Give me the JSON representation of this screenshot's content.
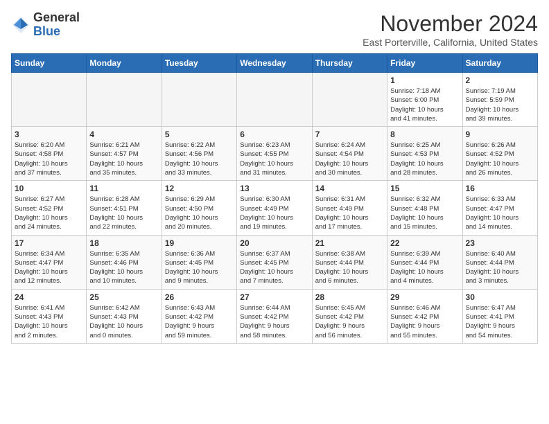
{
  "logo": {
    "general": "General",
    "blue": "Blue"
  },
  "header": {
    "title": "November 2024",
    "subtitle": "East Porterville, California, United States"
  },
  "weekdays": [
    "Sunday",
    "Monday",
    "Tuesday",
    "Wednesday",
    "Thursday",
    "Friday",
    "Saturday"
  ],
  "weeks": [
    [
      {
        "day": "",
        "info": ""
      },
      {
        "day": "",
        "info": ""
      },
      {
        "day": "",
        "info": ""
      },
      {
        "day": "",
        "info": ""
      },
      {
        "day": "",
        "info": ""
      },
      {
        "day": "1",
        "info": "Sunrise: 7:18 AM\nSunset: 6:00 PM\nDaylight: 10 hours\nand 41 minutes."
      },
      {
        "day": "2",
        "info": "Sunrise: 7:19 AM\nSunset: 5:59 PM\nDaylight: 10 hours\nand 39 minutes."
      }
    ],
    [
      {
        "day": "3",
        "info": "Sunrise: 6:20 AM\nSunset: 4:58 PM\nDaylight: 10 hours\nand 37 minutes."
      },
      {
        "day": "4",
        "info": "Sunrise: 6:21 AM\nSunset: 4:57 PM\nDaylight: 10 hours\nand 35 minutes."
      },
      {
        "day": "5",
        "info": "Sunrise: 6:22 AM\nSunset: 4:56 PM\nDaylight: 10 hours\nand 33 minutes."
      },
      {
        "day": "6",
        "info": "Sunrise: 6:23 AM\nSunset: 4:55 PM\nDaylight: 10 hours\nand 31 minutes."
      },
      {
        "day": "7",
        "info": "Sunrise: 6:24 AM\nSunset: 4:54 PM\nDaylight: 10 hours\nand 30 minutes."
      },
      {
        "day": "8",
        "info": "Sunrise: 6:25 AM\nSunset: 4:53 PM\nDaylight: 10 hours\nand 28 minutes."
      },
      {
        "day": "9",
        "info": "Sunrise: 6:26 AM\nSunset: 4:52 PM\nDaylight: 10 hours\nand 26 minutes."
      }
    ],
    [
      {
        "day": "10",
        "info": "Sunrise: 6:27 AM\nSunset: 4:52 PM\nDaylight: 10 hours\nand 24 minutes."
      },
      {
        "day": "11",
        "info": "Sunrise: 6:28 AM\nSunset: 4:51 PM\nDaylight: 10 hours\nand 22 minutes."
      },
      {
        "day": "12",
        "info": "Sunrise: 6:29 AM\nSunset: 4:50 PM\nDaylight: 10 hours\nand 20 minutes."
      },
      {
        "day": "13",
        "info": "Sunrise: 6:30 AM\nSunset: 4:49 PM\nDaylight: 10 hours\nand 19 minutes."
      },
      {
        "day": "14",
        "info": "Sunrise: 6:31 AM\nSunset: 4:49 PM\nDaylight: 10 hours\nand 17 minutes."
      },
      {
        "day": "15",
        "info": "Sunrise: 6:32 AM\nSunset: 4:48 PM\nDaylight: 10 hours\nand 15 minutes."
      },
      {
        "day": "16",
        "info": "Sunrise: 6:33 AM\nSunset: 4:47 PM\nDaylight: 10 hours\nand 14 minutes."
      }
    ],
    [
      {
        "day": "17",
        "info": "Sunrise: 6:34 AM\nSunset: 4:47 PM\nDaylight: 10 hours\nand 12 minutes."
      },
      {
        "day": "18",
        "info": "Sunrise: 6:35 AM\nSunset: 4:46 PM\nDaylight: 10 hours\nand 10 minutes."
      },
      {
        "day": "19",
        "info": "Sunrise: 6:36 AM\nSunset: 4:45 PM\nDaylight: 10 hours\nand 9 minutes."
      },
      {
        "day": "20",
        "info": "Sunrise: 6:37 AM\nSunset: 4:45 PM\nDaylight: 10 hours\nand 7 minutes."
      },
      {
        "day": "21",
        "info": "Sunrise: 6:38 AM\nSunset: 4:44 PM\nDaylight: 10 hours\nand 6 minutes."
      },
      {
        "day": "22",
        "info": "Sunrise: 6:39 AM\nSunset: 4:44 PM\nDaylight: 10 hours\nand 4 minutes."
      },
      {
        "day": "23",
        "info": "Sunrise: 6:40 AM\nSunset: 4:44 PM\nDaylight: 10 hours\nand 3 minutes."
      }
    ],
    [
      {
        "day": "24",
        "info": "Sunrise: 6:41 AM\nSunset: 4:43 PM\nDaylight: 10 hours\nand 2 minutes."
      },
      {
        "day": "25",
        "info": "Sunrise: 6:42 AM\nSunset: 4:43 PM\nDaylight: 10 hours\nand 0 minutes."
      },
      {
        "day": "26",
        "info": "Sunrise: 6:43 AM\nSunset: 4:42 PM\nDaylight: 9 hours\nand 59 minutes."
      },
      {
        "day": "27",
        "info": "Sunrise: 6:44 AM\nSunset: 4:42 PM\nDaylight: 9 hours\nand 58 minutes."
      },
      {
        "day": "28",
        "info": "Sunrise: 6:45 AM\nSunset: 4:42 PM\nDaylight: 9 hours\nand 56 minutes."
      },
      {
        "day": "29",
        "info": "Sunrise: 6:46 AM\nSunset: 4:42 PM\nDaylight: 9 hours\nand 55 minutes."
      },
      {
        "day": "30",
        "info": "Sunrise: 6:47 AM\nSunset: 4:41 PM\nDaylight: 9 hours\nand 54 minutes."
      }
    ]
  ]
}
